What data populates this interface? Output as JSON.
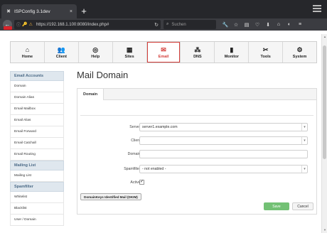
{
  "browser": {
    "tab_title": "ISPConfig 3.1dev",
    "tab_close": "×",
    "new_tab": "+",
    "url": "https://192.168.1.100:8080/index.php#",
    "search_placeholder": "Suchen",
    "warning_color": "#d8232a"
  },
  "main_nav": {
    "active": "Email",
    "items": [
      {
        "label": "Home",
        "icon": "home-icon"
      },
      {
        "label": "Client",
        "icon": "users-icon"
      },
      {
        "label": "Help",
        "icon": "lifebuoy-icon"
      },
      {
        "label": "Sites",
        "icon": "server-icon"
      },
      {
        "label": "Email",
        "icon": "envelope-icon"
      },
      {
        "label": "DNS",
        "icon": "network-icon"
      },
      {
        "label": "Monitor",
        "icon": "remote-icon"
      },
      {
        "label": "Tools",
        "icon": "tools-icon"
      },
      {
        "label": "System",
        "icon": "gear-icon"
      }
    ]
  },
  "sidebar": {
    "sections": [
      {
        "title": "Email Accounts",
        "items": [
          "Domain",
          "Domain Alias",
          "Email Mailbox",
          "Email Alias",
          "Email Forward",
          "Email Catchall",
          "Email Routing"
        ]
      },
      {
        "title": "Mailing List",
        "items": [
          "Mailing List"
        ]
      },
      {
        "title": "Spamfilter",
        "items": [
          "Whitelist",
          "Blacklist",
          "User / Domain"
        ]
      }
    ]
  },
  "page": {
    "title": "Mail Domain",
    "tab": "Domain"
  },
  "form": {
    "server_label": "Server:",
    "server_value": "server1.example.com",
    "client_label": "Client:",
    "client_value": "",
    "domain_label": "Domain:",
    "domain_value": "",
    "spamfilter_label": "Spamfilter:",
    "spamfilter_value": "- not enabled -",
    "active_label": "Active:",
    "active_checked": true,
    "dkim_button": "DomainKeys Identified Mail (DKIM)",
    "save_button": "Save",
    "cancel_button": "Cancel"
  },
  "colors": {
    "accent": "#d43e3a",
    "save": "#73c175",
    "sidebar_header": "#4b6a86"
  }
}
